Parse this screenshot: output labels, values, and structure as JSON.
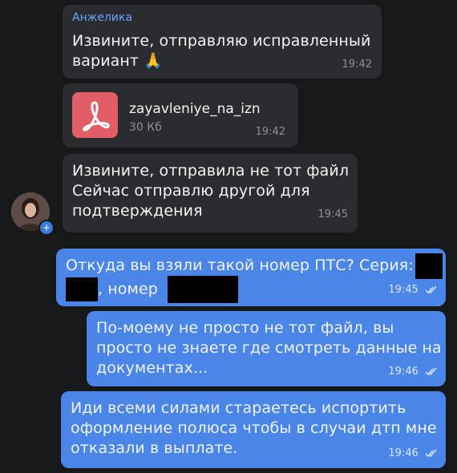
{
  "messages": {
    "m1": {
      "sender": "Анжелика",
      "text_line1": "Извините, отправляю исправленный",
      "text_line2": "вариант 🙏",
      "time": "19:42"
    },
    "m2": {
      "file_name": "zayavleniye_na_izn",
      "file_size": "30 Кб",
      "time": "19:42",
      "file_icon": "pdf-icon"
    },
    "m3": {
      "line1": "Извините, отправила не тот файл",
      "line2": "Сейчас отправлю другой для",
      "line3": "подтверждения",
      "time": "19:45"
    },
    "m4": {
      "line1": "Откуда вы взяли такой номер ПТС? Серия:",
      "line2_mid": ", номер",
      "time": "19:45"
    },
    "m5": {
      "line1": "По-моему не просто не тот файл, вы",
      "line2": "просто не знаете где смотреть данные на",
      "line3": "документах...",
      "time": "19:46"
    },
    "m6": {
      "line1": "Иди всеми силами стараетесь испортить",
      "line2": "оформление полюса чтобы в случаи дтп мне",
      "line3": "отказали в выплате.",
      "time": "19:46"
    }
  },
  "avatar": {
    "plus": "+"
  },
  "colors": {
    "incoming": "#2b2c2f",
    "outgoing": "#4a86e8",
    "sender": "#6aa5ff",
    "background": "#17181a"
  }
}
